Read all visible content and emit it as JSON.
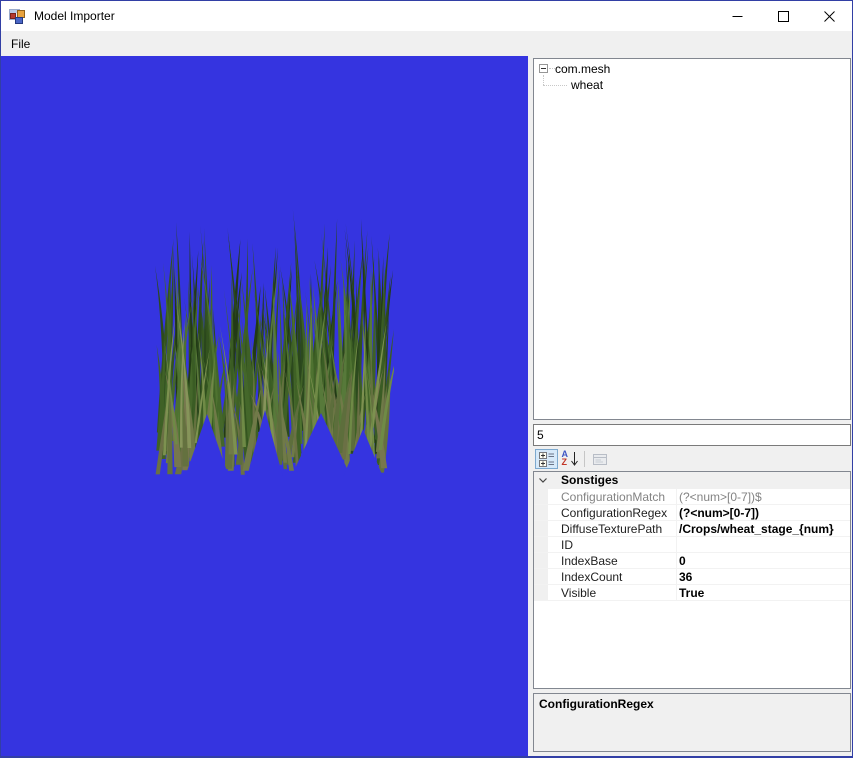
{
  "window": {
    "title": "Model Importer"
  },
  "menu": {
    "items": [
      {
        "label": "File"
      }
    ]
  },
  "viewport": {
    "model": "wheat",
    "background": "#3534e0"
  },
  "colors": {
    "accent_border": "#323fa5",
    "toolbar_checked_bg": "#d6e9f9",
    "grass_dark": "#2c4a1e",
    "grass_mid": "#44672a",
    "grass_olive": "#6b7045"
  },
  "tree": {
    "nodes": [
      {
        "label": "com.mesh",
        "state": "expanded",
        "children": [
          {
            "label": "wheat"
          }
        ]
      }
    ]
  },
  "filter_box": {
    "value": "5"
  },
  "property_toolbar": {
    "buttons": [
      {
        "name": "categorized",
        "active": true
      },
      {
        "name": "alphabetical",
        "active": false
      },
      {
        "name": "property-pages",
        "active": false,
        "disabled": true
      }
    ],
    "sort_icon_letters": {
      "a": "A",
      "z": "Z"
    }
  },
  "property_grid": {
    "category": {
      "label": "Sonstiges",
      "expanded": true
    },
    "rows": [
      {
        "name": "ConfigurationMatch",
        "value": "(?<num>[0-7])$",
        "readonly": true,
        "bold": false
      },
      {
        "name": "ConfigurationRegex",
        "value": "(?<num>[0-7])",
        "readonly": false,
        "bold": true
      },
      {
        "name": "DiffuseTexturePath",
        "value": "/Crops/wheat_stage_{num}",
        "readonly": false,
        "bold": true
      },
      {
        "name": "ID",
        "value": "",
        "readonly": false,
        "bold": true
      },
      {
        "name": "IndexBase",
        "value": "0",
        "readonly": false,
        "bold": true
      },
      {
        "name": "IndexCount",
        "value": "36",
        "readonly": false,
        "bold": true
      },
      {
        "name": "Visible",
        "value": "True",
        "readonly": false,
        "bold": true
      }
    ]
  },
  "description_panel": {
    "title": "ConfigurationRegex"
  }
}
